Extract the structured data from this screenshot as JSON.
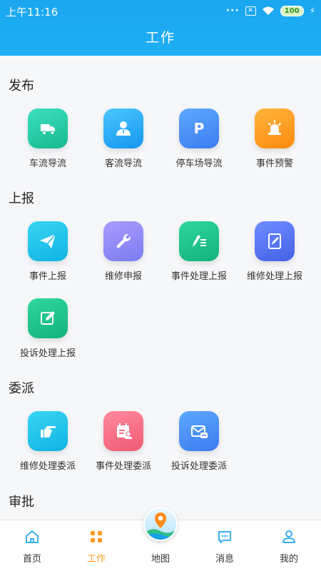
{
  "status_bar": {
    "time": "上午11:16",
    "battery": "100"
  },
  "header": {
    "title": "工作"
  },
  "sections": [
    {
      "title": "发布",
      "items": [
        {
          "label": "车流导流",
          "icon": "truck-icon"
        },
        {
          "label": "客流导流",
          "icon": "person-icon"
        },
        {
          "label": "停车场导流",
          "icon": "parking-icon"
        },
        {
          "label": "事件预警",
          "icon": "alarm-light-icon"
        }
      ]
    },
    {
      "title": "上报",
      "items": [
        {
          "label": "事件上报",
          "icon": "send-icon"
        },
        {
          "label": "维修申报",
          "icon": "wrench-icon"
        },
        {
          "label": "事件处理上报",
          "icon": "pen-list-icon"
        },
        {
          "label": "维修处理上报",
          "icon": "edit-doc-icon"
        },
        {
          "label": "投诉处理上报",
          "icon": "edit-square-icon"
        }
      ]
    },
    {
      "title": "委派",
      "items": [
        {
          "label": "维修处理委派",
          "icon": "pointing-hand-icon"
        },
        {
          "label": "事件处理委派",
          "icon": "calendar-person-icon"
        },
        {
          "label": "投诉处理委派",
          "icon": "complaint-mail-icon"
        }
      ]
    },
    {
      "title": "审批",
      "items": []
    }
  ],
  "tabbar": {
    "items": [
      {
        "label": "首页",
        "icon": "home-icon"
      },
      {
        "label": "工作",
        "icon": "grid-icon",
        "active": true
      },
      {
        "label": "地图",
        "icon": "map-pin-icon"
      },
      {
        "label": "消息",
        "icon": "message-icon"
      },
      {
        "label": "我的",
        "icon": "user-icon"
      }
    ]
  },
  "colors": {
    "header": "#1ba7f0",
    "active_tab": "#ff9a1a",
    "background": "#f6f7f9"
  }
}
